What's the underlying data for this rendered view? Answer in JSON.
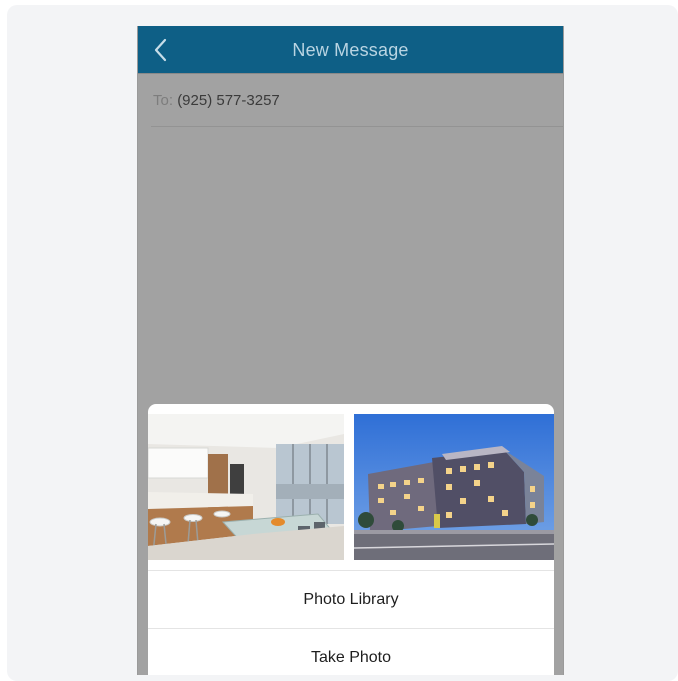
{
  "navbar": {
    "title": "New Message",
    "back_icon": "chevron-left-icon",
    "background": "#0e5f86"
  },
  "compose": {
    "to_label": "To:",
    "to_value": "(925) 577-3257"
  },
  "attachment_sheet": {
    "thumbnails": [
      {
        "name": "kitchen-photo"
      },
      {
        "name": "building-photo"
      }
    ],
    "actions": {
      "photo_library": "Photo Library",
      "take_photo": "Take Photo"
    }
  }
}
